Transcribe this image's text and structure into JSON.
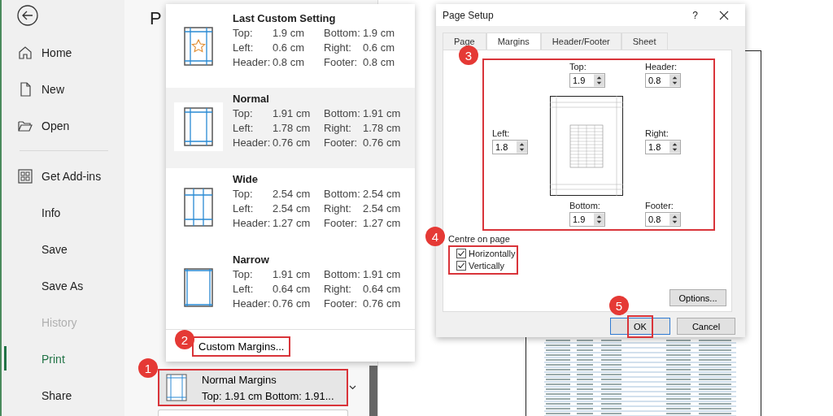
{
  "sidebar": {
    "items": [
      {
        "label": "Home",
        "kind": "home",
        "disabled": false,
        "selected": false
      },
      {
        "label": "New",
        "kind": "new",
        "disabled": false,
        "selected": false
      },
      {
        "label": "Open",
        "kind": "open",
        "disabled": false,
        "selected": false
      },
      {
        "label": "Get Add-ins",
        "kind": "addins",
        "disabled": false,
        "selected": false
      },
      {
        "label": "Info",
        "kind": "plain",
        "disabled": false,
        "selected": false
      },
      {
        "label": "Save",
        "kind": "plain",
        "disabled": false,
        "selected": false
      },
      {
        "label": "Save As",
        "kind": "plain",
        "disabled": false,
        "selected": false
      },
      {
        "label": "History",
        "kind": "plain",
        "disabled": true,
        "selected": false
      },
      {
        "label": "Print",
        "kind": "plain",
        "disabled": false,
        "selected": true
      },
      {
        "label": "Share",
        "kind": "plain",
        "disabled": false,
        "selected": false
      }
    ]
  },
  "heading": "P",
  "margins_menu": {
    "options": [
      {
        "name": "Last Custom Setting",
        "kind": "custom",
        "selected": false,
        "rows": [
          [
            "Top:",
            "1.9 cm",
            "Bottom:",
            "1.9 cm"
          ],
          [
            "Left:",
            "0.6 cm",
            "Right:",
            "0.6 cm"
          ],
          [
            "Header:",
            "0.8 cm",
            "Footer:",
            "0.8 cm"
          ]
        ]
      },
      {
        "name": "Normal",
        "kind": "normal",
        "selected": true,
        "rows": [
          [
            "Top:",
            "1.91 cm",
            "Bottom:",
            "1.91 cm"
          ],
          [
            "Left:",
            "1.78 cm",
            "Right:",
            "1.78 cm"
          ],
          [
            "Header:",
            "0.76 cm",
            "Footer:",
            "0.76 cm"
          ]
        ]
      },
      {
        "name": "Wide",
        "kind": "wide",
        "selected": false,
        "rows": [
          [
            "Top:",
            "2.54 cm",
            "Bottom:",
            "2.54 cm"
          ],
          [
            "Left:",
            "2.54 cm",
            "Right:",
            "2.54 cm"
          ],
          [
            "Header:",
            "1.27 cm",
            "Footer:",
            "1.27 cm"
          ]
        ]
      },
      {
        "name": "Narrow",
        "kind": "narrow",
        "selected": false,
        "rows": [
          [
            "Top:",
            "1.91 cm",
            "Bottom:",
            "1.91 cm"
          ],
          [
            "Left:",
            "0.64 cm",
            "Right:",
            "0.64 cm"
          ],
          [
            "Header:",
            "0.76 cm",
            "Footer:",
            "0.76 cm"
          ]
        ]
      }
    ],
    "custom_margins": {
      "label": "Custom Margins...",
      "highlighted": true
    }
  },
  "margins_button": {
    "title": "Normal Margins",
    "summary": "Top: 1.91 cm Bottom: 1.91...",
    "highlighted": true
  },
  "dialog": {
    "title": "Page Setup",
    "help": "?",
    "tabs": [
      {
        "label": "Page",
        "selected": false
      },
      {
        "label": "Margins",
        "selected": true
      },
      {
        "label": "Header/Footer",
        "selected": false
      },
      {
        "label": "Sheet",
        "selected": false
      }
    ],
    "fields_highlighted": true,
    "fields": [
      {
        "label": "Top:",
        "value": "1.9"
      },
      {
        "label": "Header:",
        "value": "0.8"
      },
      {
        "label": "Left:",
        "value": "1.8"
      },
      {
        "label": "Right:",
        "value": "1.8"
      },
      {
        "label": "Bottom:",
        "value": "1.9"
      },
      {
        "label": "Footer:",
        "value": "0.8"
      }
    ],
    "centre": {
      "title": "Centre on page",
      "highlighted": true,
      "options": [
        {
          "label": "Horizontally",
          "checked": true
        },
        {
          "label": "Vertically",
          "checked": true
        }
      ]
    },
    "options_button": "Options...",
    "ok": {
      "label": "OK",
      "highlighted": true
    },
    "cancel": "Cancel"
  },
  "callouts": [
    "1",
    "2",
    "3",
    "4",
    "5"
  ]
}
